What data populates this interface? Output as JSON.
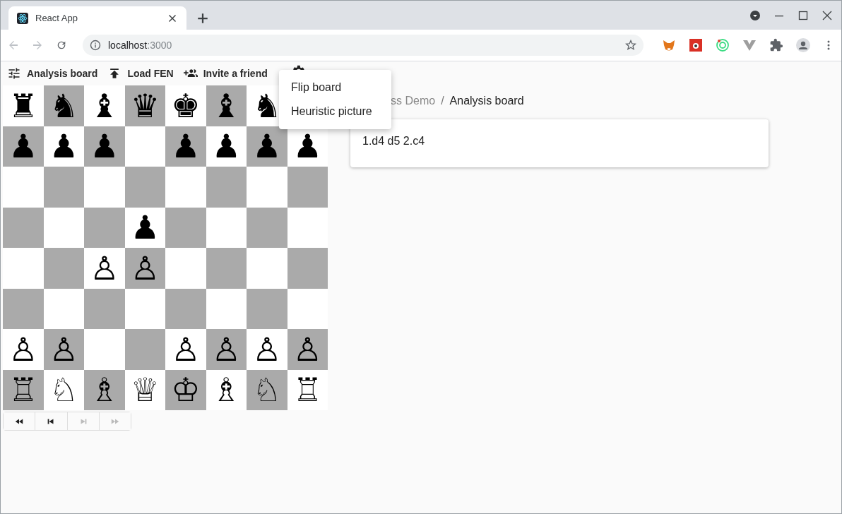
{
  "browser": {
    "tab_title": "React App",
    "url_host": "localhost",
    "url_port": ":3000"
  },
  "toolbar": {
    "items": [
      {
        "kind": "tune",
        "label": "Analysis board"
      },
      {
        "kind": "upload",
        "label": "Load FEN"
      },
      {
        "kind": "people",
        "label": "Invite a friend"
      }
    ]
  },
  "menu": {
    "items": [
      {
        "label": "Flip board"
      },
      {
        "label": "Heuristic picture"
      }
    ]
  },
  "board": {
    "ranks": [
      [
        {
          "kind": "piece",
          "piece": "♜"
        },
        {
          "kind": "piece",
          "piece": "♞"
        },
        {
          "kind": "piece",
          "piece": "♝"
        },
        {
          "kind": "piece",
          "piece": "♛"
        },
        {
          "kind": "piece",
          "piece": "♚"
        },
        {
          "kind": "piece",
          "piece": "♝"
        },
        {
          "kind": "piece",
          "piece": "♞"
        },
        {
          "kind": "covered"
        }
      ],
      [
        {
          "kind": "piece",
          "piece": "♟"
        },
        {
          "kind": "piece",
          "piece": "♟"
        },
        {
          "kind": "piece",
          "piece": "♟"
        },
        {
          "kind": "empty"
        },
        {
          "kind": "piece",
          "piece": "♟"
        },
        {
          "kind": "piece",
          "piece": "♟"
        },
        {
          "kind": "piece",
          "piece": "♟"
        },
        {
          "kind": "piece",
          "piece": "♟"
        }
      ],
      [
        {
          "kind": "empty"
        },
        {
          "kind": "empty"
        },
        {
          "kind": "empty"
        },
        {
          "kind": "empty"
        },
        {
          "kind": "empty"
        },
        {
          "kind": "empty"
        },
        {
          "kind": "empty"
        },
        {
          "kind": "empty"
        }
      ],
      [
        {
          "kind": "empty"
        },
        {
          "kind": "empty"
        },
        {
          "kind": "empty"
        },
        {
          "kind": "piece",
          "piece": "♟"
        },
        {
          "kind": "empty"
        },
        {
          "kind": "empty"
        },
        {
          "kind": "empty"
        },
        {
          "kind": "empty"
        }
      ],
      [
        {
          "kind": "empty"
        },
        {
          "kind": "empty"
        },
        {
          "kind": "piece",
          "piece": "♙"
        },
        {
          "kind": "piece",
          "piece": "♙"
        },
        {
          "kind": "empty"
        },
        {
          "kind": "empty"
        },
        {
          "kind": "empty"
        },
        {
          "kind": "empty"
        }
      ],
      [
        {
          "kind": "empty"
        },
        {
          "kind": "empty"
        },
        {
          "kind": "empty"
        },
        {
          "kind": "empty"
        },
        {
          "kind": "empty"
        },
        {
          "kind": "empty"
        },
        {
          "kind": "empty"
        },
        {
          "kind": "empty"
        }
      ],
      [
        {
          "kind": "piece",
          "piece": "♙"
        },
        {
          "kind": "piece",
          "piece": "♙"
        },
        {
          "kind": "empty"
        },
        {
          "kind": "empty"
        },
        {
          "kind": "piece",
          "piece": "♙"
        },
        {
          "kind": "piece",
          "piece": "♙"
        },
        {
          "kind": "piece",
          "piece": "♙"
        },
        {
          "kind": "piece",
          "piece": "♙"
        }
      ],
      [
        {
          "kind": "piece",
          "piece": "♖"
        },
        {
          "kind": "piece",
          "piece": "♘"
        },
        {
          "kind": "piece",
          "piece": "♗"
        },
        {
          "kind": "piece",
          "piece": "♕"
        },
        {
          "kind": "piece",
          "piece": "♔"
        },
        {
          "kind": "piece",
          "piece": "♗"
        },
        {
          "kind": "piece",
          "piece": "♘"
        },
        {
          "kind": "piece",
          "piece": "♖"
        }
      ]
    ]
  },
  "navigation": [
    {
      "kind": "first",
      "disabled": false
    },
    {
      "kind": "prev",
      "disabled": false
    },
    {
      "kind": "next",
      "disabled": true
    },
    {
      "kind": "last",
      "disabled": true
    }
  ],
  "breadcrumb": {
    "parent": "ss Demo",
    "separator": "/",
    "current": "Analysis board"
  },
  "moves": "1.d4 d5 2.c4"
}
